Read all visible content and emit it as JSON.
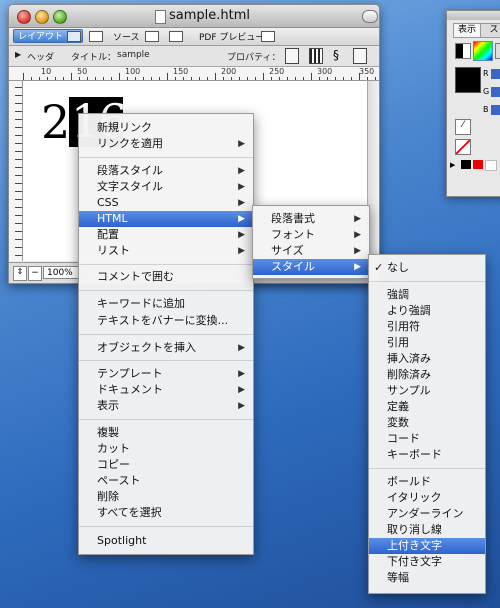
{
  "window": {
    "title": "sample.html",
    "layout_tab": "レイアウト",
    "source_tab": "ソース",
    "pdf_preview": "PDF プレビュー",
    "header_label": "ヘッダ",
    "title_label": "タイトル：",
    "title_value": "sample",
    "properties_label": "プロパティ：",
    "canvas_text_plain": "2",
    "canvas_text_highlighted": "16",
    "zoom": "100%",
    "ruler_labels": [
      "10",
      "50",
      "100",
      "150",
      "200",
      "250",
      "300",
      "350"
    ]
  },
  "panel": {
    "tab1": "表示",
    "tab2": "ス",
    "channel_r": "R",
    "channel_g": "G",
    "channel_b": "B"
  },
  "context_menu": {
    "items": [
      {
        "label": "新規リンク"
      },
      {
        "label": "リンクを適用",
        "submenu": true
      },
      {
        "label": "段落スタイル",
        "submenu": true
      },
      {
        "label": "文字スタイル",
        "submenu": true
      },
      {
        "label": "CSS",
        "submenu": true
      },
      {
        "label": "HTML",
        "submenu": true,
        "selected": true
      },
      {
        "label": "配置",
        "submenu": true
      },
      {
        "label": "リスト",
        "submenu": true
      },
      {
        "label": "コメントで囲む"
      },
      {
        "label": "キーワードに追加"
      },
      {
        "label": "テキストをバナーに変換..."
      },
      {
        "label": "オブジェクトを挿入",
        "submenu": true
      },
      {
        "label": "テンプレート",
        "submenu": true
      },
      {
        "label": "ドキュメント",
        "submenu": true
      },
      {
        "label": "表示",
        "submenu": true
      },
      {
        "label": "複製"
      },
      {
        "label": "カット"
      },
      {
        "label": "コピー"
      },
      {
        "label": "ペースト"
      },
      {
        "label": "削除"
      },
      {
        "label": "すべてを選択"
      },
      {
        "label": "Spotlight"
      }
    ]
  },
  "html_submenu": {
    "items": [
      {
        "label": "段落書式"
      },
      {
        "label": "フォント"
      },
      {
        "label": "サイズ"
      },
      {
        "label": "スタイル",
        "selected": true
      }
    ]
  },
  "style_submenu": {
    "checkmark": "✓",
    "items": [
      {
        "label": "なし",
        "checked": true
      },
      {
        "label": "強調"
      },
      {
        "label": "より強調"
      },
      {
        "label": "引用符"
      },
      {
        "label": "引用"
      },
      {
        "label": "挿入済み"
      },
      {
        "label": "削除済み"
      },
      {
        "label": "サンプル"
      },
      {
        "label": "定義"
      },
      {
        "label": "変数"
      },
      {
        "label": "コード"
      },
      {
        "label": "キーボード"
      },
      {
        "label": "ボールド"
      },
      {
        "label": "イタリック"
      },
      {
        "label": "アンダーライン"
      },
      {
        "label": "取り消し線"
      },
      {
        "label": "上付き文字",
        "selected": true
      },
      {
        "label": "下付き文字"
      },
      {
        "label": "等幅"
      }
    ]
  },
  "colors": {
    "selection": "#2d63cf",
    "desktop": "#2e6bbd"
  }
}
